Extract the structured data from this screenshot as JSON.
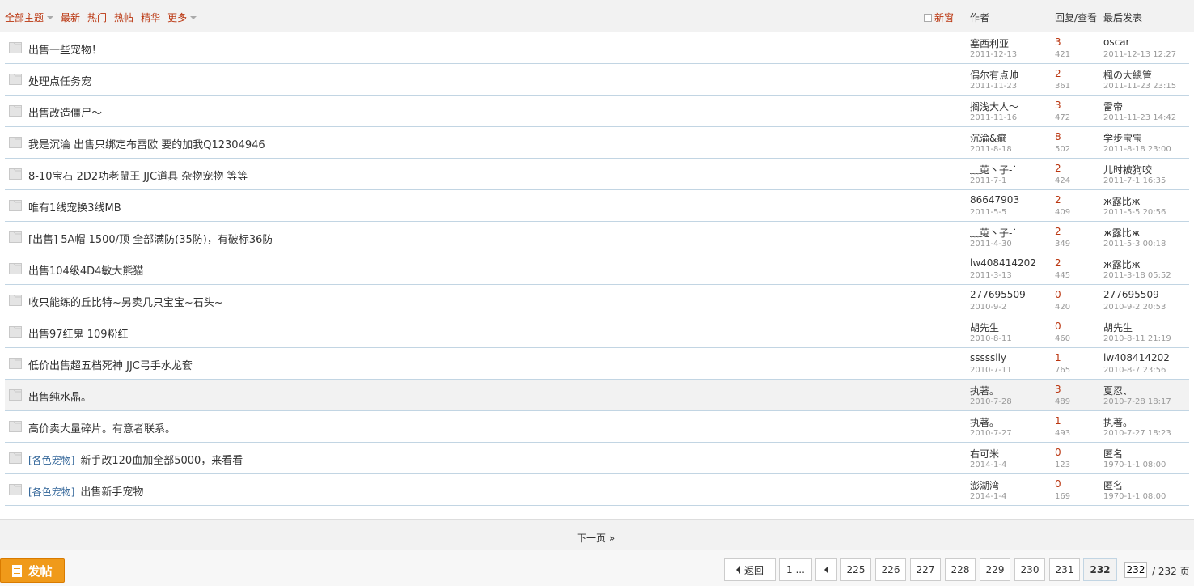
{
  "header": {
    "filters": [
      "全部主题",
      "最新",
      "热门",
      "热帖",
      "精华",
      "更多"
    ],
    "new_window": "新窗",
    "col_author": "作者",
    "col_stats": "回复/查看",
    "col_last": "最后发表"
  },
  "threads": [
    {
      "tag": "",
      "title": "出售一些宠物！",
      "author": "塞西利亚",
      "date": "2011-12-13",
      "replies": "3",
      "views": "421",
      "last_user": "oscar",
      "last_time": "2011-12-13 12:27"
    },
    {
      "tag": "",
      "title": "处理点任务宠",
      "author": "偶尔有点帅",
      "date": "2011-11-23",
      "replies": "2",
      "views": "361",
      "last_user": "楓の大總管",
      "last_time": "2011-11-23 23:15"
    },
    {
      "tag": "",
      "title": "出售改造僵尸～",
      "author": "搁浅大人～",
      "date": "2011-11-16",
      "replies": "3",
      "views": "472",
      "last_user": "雷帝",
      "last_time": "2011-11-23 14:42"
    },
    {
      "tag": "",
      "title": "我是沉淪 出售只绑定布雷欧 要的加我Q12304946",
      "author": "沉淪&癫",
      "date": "2011-8-18",
      "replies": "8",
      "views": "502",
      "last_user": "学步宝宝",
      "last_time": "2011-8-18 23:00"
    },
    {
      "tag": "",
      "title": "8-10宝石 2D2功老鼠王 JJC道具 杂物宠物 等等",
      "author": "﹏莵丶子-˙",
      "date": "2011-7-1",
      "replies": "2",
      "views": "424",
      "last_user": "儿时被狗咬",
      "last_time": "2011-7-1 16:35"
    },
    {
      "tag": "",
      "title": "唯有1线宠换3线MB",
      "author": "86647903",
      "date": "2011-5-5",
      "replies": "2",
      "views": "409",
      "last_user": "ж露比ж",
      "last_time": "2011-5-5 20:56"
    },
    {
      "tag": "",
      "title": "[出售] 5A帽 1500/顶 全部满防(35防)，有破标36防",
      "author": "﹏莵丶子-˙",
      "date": "2011-4-30",
      "replies": "2",
      "views": "349",
      "last_user": "ж露比ж",
      "last_time": "2011-5-3 00:18"
    },
    {
      "tag": "",
      "title": "出售104级4D4敏大熊猫",
      "author": "lw408414202",
      "date": "2011-3-13",
      "replies": "2",
      "views": "445",
      "last_user": "ж露比ж",
      "last_time": "2011-3-18 05:52"
    },
    {
      "tag": "",
      "title": "收只能练的丘比特~另卖几只宝宝~石头~",
      "author": "277695509",
      "date": "2010-9-2",
      "replies": "0",
      "views": "420",
      "last_user": "277695509",
      "last_time": "2010-9-2 20:53"
    },
    {
      "tag": "",
      "title": "出售97红鬼 109粉红",
      "author": "胡先生",
      "date": "2010-8-11",
      "replies": "0",
      "views": "460",
      "last_user": "胡先生",
      "last_time": "2010-8-11 21:19"
    },
    {
      "tag": "",
      "title": "低价出售超五档死神 JJC弓手水龙套",
      "author": "ssssslly",
      "date": "2010-7-11",
      "replies": "1",
      "views": "765",
      "last_user": "lw408414202",
      "last_time": "2010-8-7 23:56"
    },
    {
      "tag": "",
      "title": "出售纯水晶。",
      "author": "执著。",
      "date": "2010-7-28",
      "replies": "3",
      "views": "489",
      "last_user": "夏忍、",
      "last_time": "2010-7-28 18:17"
    },
    {
      "tag": "",
      "title": "高价卖大量碎片。有意者联系。",
      "author": "执著。",
      "date": "2010-7-27",
      "replies": "1",
      "views": "493",
      "last_user": "执著。",
      "last_time": "2010-7-27 18:23"
    },
    {
      "tag": "[各色宠物]",
      "title": "新手改120血加全部5000，来看看",
      "author": "右可米",
      "date": "2014-1-4",
      "replies": "0",
      "views": "123",
      "last_user": "匿名",
      "last_time": "1970-1-1 08:00"
    },
    {
      "tag": "[各色宠物]",
      "title": "出售新手宠物",
      "author": "澎湖湾",
      "date": "2014-1-4",
      "replies": "0",
      "views": "169",
      "last_user": "匿名",
      "last_time": "1970-1-1 08:00"
    }
  ],
  "next_page": "下一页 »",
  "post_button": "发帖",
  "pagination": {
    "back": "返回",
    "first": "1 ...",
    "pages": [
      "225",
      "226",
      "227",
      "228",
      "229",
      "230",
      "231"
    ],
    "current": "232",
    "input_value": "232",
    "total": "/ 232 页"
  },
  "colors": {
    "accent": "#ba350f",
    "border": "#c2d5e3",
    "tag": "#336699",
    "post_button": "#f09a1a"
  }
}
